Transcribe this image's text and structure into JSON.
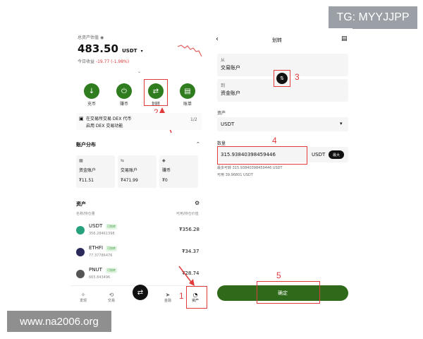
{
  "badge": "TG: MYYJJPP",
  "watermark": "www.na2006.org",
  "left": {
    "assets_label": "总资产估值",
    "eye_icon": "eye-icon",
    "balance": "483.50",
    "currency": "USDT",
    "today_label": "今日收益",
    "today_value": "-19.77 (-1.98%)",
    "actions": [
      {
        "label": "充币",
        "icon": "deposit-icon"
      },
      {
        "label": "赚币",
        "icon": "earn-icon"
      },
      {
        "label": "划转",
        "icon": "transfer-icon"
      },
      {
        "label": "账单",
        "icon": "bill-icon"
      }
    ],
    "dex_line1": "在交易所交易 DEX 代币",
    "dex_line2": "启用 DEX 交易功能",
    "dex_page": "1/2",
    "account_section": "账户分布",
    "accounts": [
      {
        "name": "资金账户",
        "value": "₮11.51"
      },
      {
        "name": "交易账户",
        "value": "₮471.99"
      },
      {
        "name": "赚币",
        "value": "₮0"
      }
    ],
    "assets_section": "资产",
    "col_left": "名称/持仓量",
    "col_right": "可用/持仓价值",
    "coins": [
      {
        "name": "USDT",
        "tag": "可划转",
        "amount": "356.28461398",
        "value": "₮356.28",
        "color": "#26a17b"
      },
      {
        "name": "ETHFI",
        "tag": "可划转",
        "amount": "77.37786476",
        "value": "₮34.37",
        "color": "#2a2a5a"
      },
      {
        "name": "PNUT",
        "tag": "可划转",
        "amount": "665.843496",
        "value": "₮28.74",
        "color": "#555555"
      }
    ],
    "nav": [
      {
        "label": "发现"
      },
      {
        "label": "交易"
      },
      {
        "label": "金融"
      },
      {
        "label": "资产"
      }
    ],
    "markers": [
      "1",
      "2"
    ]
  },
  "right": {
    "title": "划转",
    "from_label": "从",
    "from_value": "交易账户",
    "to_label": "到",
    "to_value": "资金账户",
    "asset_label": "资产",
    "asset_value": "USDT",
    "amount_label": "数量",
    "amount_value": "315.93840398459446",
    "amount_unit": "USDT",
    "max_label": "最大",
    "max_transfer": "最多可转 315.93840398459446 USDT",
    "free_label": "可用 39.96801 USDT",
    "confirm_label": "确定",
    "markers": [
      "3",
      "4",
      "5"
    ]
  },
  "colors": {
    "accent_green": "#2f7d1f",
    "annotation_red": "#e03b3b"
  }
}
